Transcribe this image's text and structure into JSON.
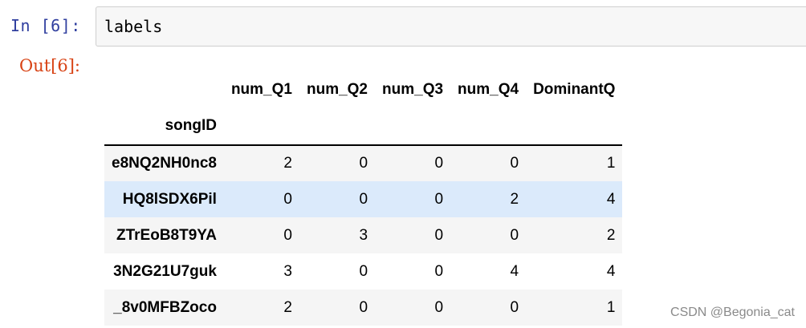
{
  "input_cell": {
    "prompt": "In  [6]:",
    "code": "labels"
  },
  "output_cell": {
    "prompt": "Out[6]:"
  },
  "dataframe": {
    "columns": [
      "num_Q1",
      "num_Q2",
      "num_Q3",
      "num_Q4",
      "DominantQ"
    ],
    "index_name": "songID",
    "rows": [
      {
        "index": "e8NQ2NH0nc8",
        "values": [
          "2",
          "0",
          "0",
          "0",
          "1"
        ]
      },
      {
        "index": "HQ8lSDX6Pil",
        "values": [
          "0",
          "0",
          "0",
          "2",
          "4"
        ]
      },
      {
        "index": "ZTrEoB8T9YA",
        "values": [
          "0",
          "3",
          "0",
          "0",
          "2"
        ]
      },
      {
        "index": "3N2G21U7guk",
        "values": [
          "3",
          "0",
          "0",
          "4",
          "4"
        ]
      },
      {
        "index": "_8v0MFBZoco",
        "values": [
          "2",
          "0",
          "0",
          "0",
          "1"
        ]
      }
    ]
  },
  "watermark": "CSDN @Begonia_cat",
  "colors": {
    "in_prompt": "#303f9f",
    "out_prompt": "#d84315",
    "hover_row": "#dbeafb",
    "odd_row": "#f5f5f5"
  }
}
